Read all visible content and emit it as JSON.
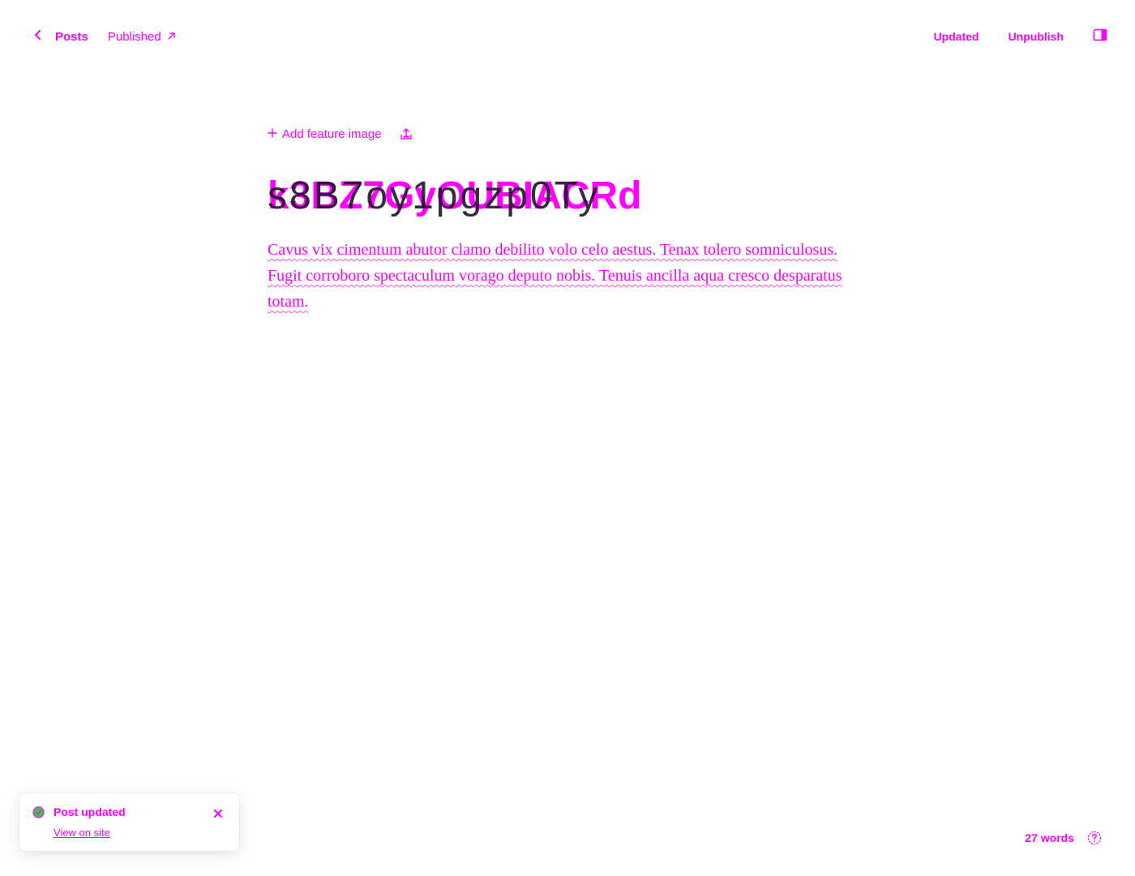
{
  "header": {
    "back_label": "Posts",
    "status_label": "Published",
    "update_label": "Updated",
    "unpublish_label": "Unpublish"
  },
  "editor": {
    "feature_image_label": "Add feature image",
    "title": "k3BZ7GyOUBIACRd",
    "title_overlay": "s8B7oy1pgzp0Ty",
    "body": "Cavus vix cimentum abutor clamo debilito volo celo aestus. Tenax tolero somniculosus. Fugit corroboro spectaculum vorago deputo nobis. Tenuis ancilla aqua cresco desparatus totam."
  },
  "toast": {
    "title": "Post updated",
    "link_label": "View on site"
  },
  "footer": {
    "word_count": "27 words"
  },
  "colors": {
    "accent": "#ff00ff",
    "success": "#30cf43"
  }
}
